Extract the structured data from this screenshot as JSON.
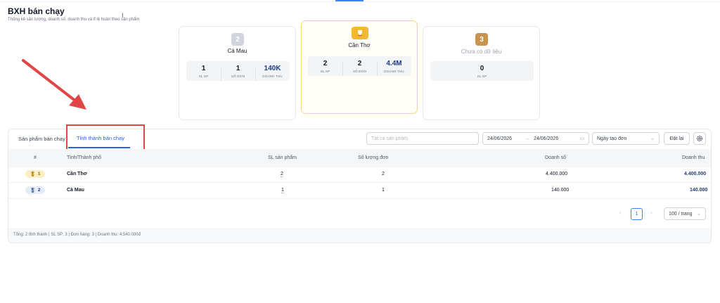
{
  "header": {
    "title": "BXH bán chạy",
    "subtitle": "Thống kê sản lượng, doanh số, doanh thu và tỉ lệ hoàn theo sản phẩm"
  },
  "podium": [
    {
      "rank": "2",
      "name": "Cà Mau",
      "stats": [
        {
          "value": "1",
          "label": "SL SP"
        },
        {
          "value": "1",
          "label": "SỐ ĐƠN"
        },
        {
          "value": "140K",
          "label": "DOANH THU"
        }
      ]
    },
    {
      "rank": "",
      "name": "Cần Thơ",
      "stats": [
        {
          "value": "2",
          "label": "SL SP"
        },
        {
          "value": "2",
          "label": "SỐ ĐƠN"
        },
        {
          "value": "4.4M",
          "label": "DOANH THU"
        }
      ]
    },
    {
      "rank": "3",
      "name": "Chưa có dữ liệu",
      "stats": [
        {
          "value": "0",
          "label": "SL SP"
        }
      ]
    }
  ],
  "tabs": [
    {
      "label": "Sản phẩm bán chạy"
    },
    {
      "label": "Tỉnh thành bán chạy"
    }
  ],
  "filters": {
    "product_placeholder": "Tất cả sản phẩm",
    "date_from": "24/06/2026",
    "date_to": "24/06/2026",
    "date_separator": "→",
    "date_type": "Ngày tạo đơn",
    "reset_label": "Đặt lại"
  },
  "table": {
    "columns": [
      "#",
      "Tỉnh/Thành phố",
      "SL sản phẩm",
      "Số lượng đơn",
      "Doanh số",
      "Doanh thu"
    ],
    "rows": [
      {
        "rank": "1",
        "province": "Cần Thơ",
        "qty": "2",
        "orders": "2",
        "sales": "4.400.000",
        "revenue": "4.400.000"
      },
      {
        "rank": "2",
        "province": "Cà Mau",
        "qty": "1",
        "orders": "1",
        "sales": "140.000",
        "revenue": "140.000"
      }
    ]
  },
  "pagination": {
    "current_page": "1",
    "page_size": "100 / trang",
    "prev": "‹",
    "next": "›"
  },
  "summary": "Tổng: 2 tỉnh thành  |  SL SP: 3  |  Đơn hàng: 3  |  Doanh thu: 4.540.000đ",
  "colors": {
    "accent": "#2563eb",
    "gold": "#f4b731",
    "silver": "#d1d5db",
    "bronze": "#c89551",
    "annotation": "#e04646"
  }
}
